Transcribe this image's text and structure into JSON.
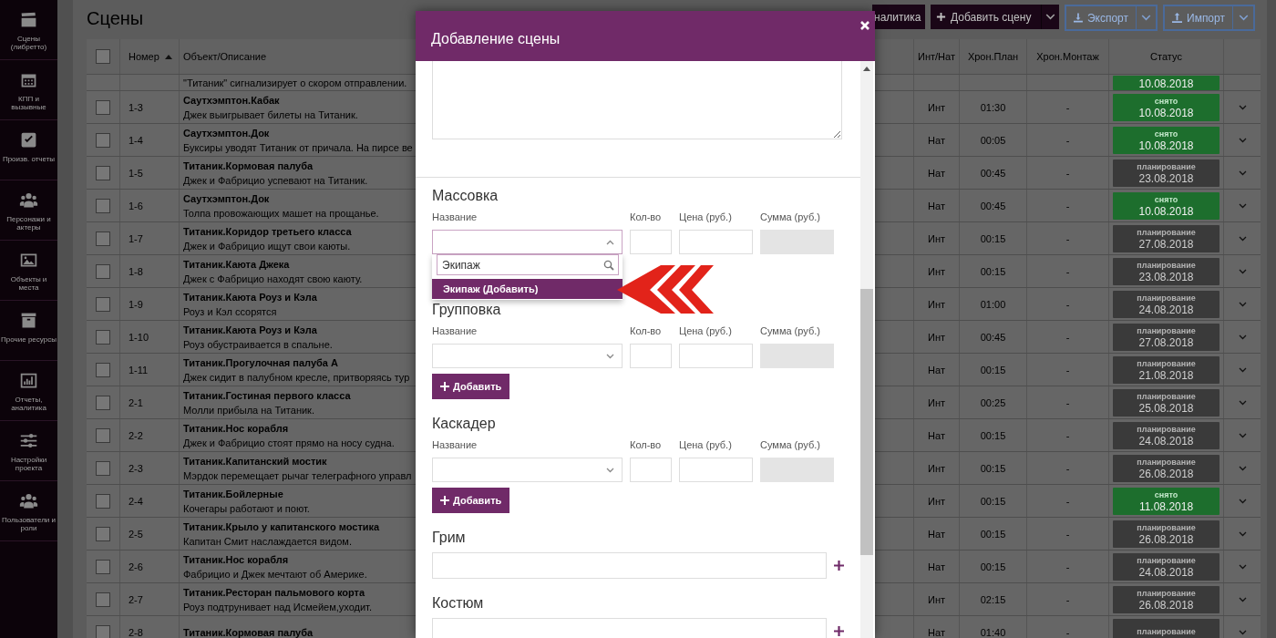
{
  "sidebar": {
    "items": [
      {
        "label": "Сцены (либретто)"
      },
      {
        "label": "КПП и вызывные"
      },
      {
        "label": "Произв. отчеты"
      },
      {
        "label": "Персонажи и актеры"
      },
      {
        "label": "Объекты и места"
      },
      {
        "label": "Прочие ресурсы"
      },
      {
        "label": "Отчеты, аналитика"
      },
      {
        "label": "Настройки проекта"
      },
      {
        "label": "Пользователи и роли"
      }
    ]
  },
  "page": {
    "title": "Сцены"
  },
  "toolbar": {
    "buttons": [
      {
        "label": "налитика",
        "kind": "dark",
        "split": false
      },
      {
        "label": "Добавить сцену",
        "kind": "primary",
        "split": true
      },
      {
        "label": "Экспорт",
        "kind": "outline",
        "split": true
      },
      {
        "label": "Импорт",
        "kind": "outline",
        "split": true
      }
    ]
  },
  "table": {
    "select_all": {
      "checked": false
    },
    "columns": [
      {
        "label": "Номер",
        "sorted_ascending": true
      },
      {
        "label": "Объект/Описание",
        "sorted_ascending": false
      },
      {
        "label": "Инт/Нат",
        "sorted_ascending": false
      },
      {
        "label": "Хрон.План",
        "sorted_ascending": false
      },
      {
        "label": "Хрон.Монтаж",
        "sorted_ascending": false
      },
      {
        "label": "Статус",
        "sorted_ascending": false
      }
    ],
    "rows": [
      {
        "description": "\"Титаник\" сигнализирует о скором отправлении.",
        "status": {
          "kind": "done",
          "date": "10.08.2018"
        }
      },
      {
        "checked": false,
        "number": "1-3",
        "title": "Саутхэмптон.Кабак",
        "description": "Джек выигрывает билеты на Титаник.",
        "int_nat": "Инт",
        "plan": "01:30",
        "montage": "-",
        "status": {
          "kind": "done",
          "label": "снято",
          "date": "10.08.2018"
        }
      },
      {
        "checked": false,
        "number": "1-4",
        "title": "Саутхэмптон.Док",
        "description": "Буксиры уводят Титаник от причала. На пирсе ве",
        "int_nat": "Нат",
        "plan": "00:05",
        "montage": "-",
        "status": {
          "kind": "done",
          "label": "снято",
          "date": "10.08.2018"
        }
      },
      {
        "checked": false,
        "number": "1-5",
        "title": "Титаник.Кормовая палуба",
        "description": "Джек и Фабрицио успевают на Титаник.",
        "int_nat": "Нат",
        "plan": "00:45",
        "montage": "-",
        "status": {
          "kind": "planned",
          "label": "планирование",
          "date": "23.08.2018"
        }
      },
      {
        "checked": false,
        "number": "1-6",
        "title": "Саутхэмптон.Док",
        "description": "Толпа провожающих машет на прощанье.",
        "int_nat": "Нат",
        "plan": "00:45",
        "montage": "-",
        "status": {
          "kind": "done",
          "label": "снято",
          "date": "10.08.2018"
        }
      },
      {
        "checked": false,
        "number": "1-7",
        "title": "Титаник.Коридор третьего класса",
        "description": "Джек и Фабрицио ищут свои каюты.",
        "int_nat": "Инт",
        "plan": "00:15",
        "montage": "-",
        "status": {
          "kind": "planned",
          "label": "планирование",
          "date": "27.08.2018"
        }
      },
      {
        "checked": false,
        "number": "1-8",
        "title": "Титаник.Каюта Джека",
        "description": "Джек с Фабрицио находят свою каюту.",
        "int_nat": "Инт",
        "plan": "00:15",
        "montage": "-",
        "status": {
          "kind": "planned",
          "label": "планирование",
          "date": "23.08.2018"
        }
      },
      {
        "checked": false,
        "number": "1-9",
        "title": "Титаник.Каюта Роуз и Кэла",
        "description": "Роуз и Кэл ссорятся",
        "int_nat": "Инт",
        "plan": "01:00",
        "montage": "-",
        "status": {
          "kind": "planned",
          "label": "планирование",
          "date": "24.08.2018"
        }
      },
      {
        "checked": false,
        "number": "1-10",
        "title": "Титаник.Каюта Роуз и Кэла",
        "description": "Роуз обустраивается в спальне.",
        "int_nat": "Инт",
        "plan": "00:45",
        "montage": "-",
        "status": {
          "kind": "planned",
          "label": "планирование",
          "date": "27.08.2018"
        }
      },
      {
        "checked": false,
        "number": "1-11",
        "title": "Титаник.Прогулочная палуба А",
        "description": "Джек сидит в палубном кресле, притворяясь тур",
        "int_nat": "Нат",
        "plan": "00:15",
        "montage": "-",
        "status": {
          "kind": "planned",
          "label": "планирование",
          "date": "21.08.2018"
        }
      },
      {
        "checked": false,
        "number": "2-1",
        "title": "Титаник.Гостиная первого класса",
        "description": "Молли прибыла на Титаник.",
        "int_nat": "Инт",
        "plan": "00:25",
        "montage": "-",
        "status": {
          "kind": "planned",
          "label": "планирование",
          "date": "25.08.2018"
        }
      },
      {
        "checked": false,
        "number": "2-2",
        "title": "Титаник.Нос корабля",
        "description": "Джек и Фабрицио стоят прямо на носу судна.",
        "int_nat": "Нат",
        "plan": "00:15",
        "montage": "-",
        "status": {
          "kind": "planned",
          "label": "планирование",
          "date": "24.08.2018"
        }
      },
      {
        "checked": false,
        "number": "2-3",
        "title": "Титаник.Капитанский мостик",
        "description": "Мэрдок перемещает рычаг телеграфного управл",
        "int_nat": "Инт",
        "plan": "00:15",
        "montage": "-",
        "status": {
          "kind": "planned",
          "label": "планирование",
          "date": "26.08.2018"
        }
      },
      {
        "checked": false,
        "number": "2-4",
        "title": "Титаник.Бойлерные",
        "description": "Кочегары работают и поют.",
        "int_nat": "Инт",
        "plan": "00:15",
        "montage": "-",
        "status": {
          "kind": "done",
          "label": "снято",
          "date": "11.08.2018"
        }
      },
      {
        "checked": false,
        "number": "2-5",
        "title": "Титаник.Крыло у капитанского мостика",
        "description": "Капитан Смит наслаждается видом.",
        "int_nat": "Нат",
        "plan": "00:15",
        "montage": "-",
        "status": {
          "kind": "planned",
          "label": "планирование",
          "date": "26.08.2018"
        }
      },
      {
        "checked": false,
        "number": "2-6",
        "title": "Титаник.Нос корабля",
        "description": "Фабрицио и Джек мечтают об Америке.",
        "int_nat": "Нат",
        "plan": "00:15",
        "montage": "-",
        "status": {
          "kind": "planned",
          "label": "планирование",
          "date": "24.08.2018"
        }
      },
      {
        "checked": false,
        "number": "2-7",
        "title": "Титаник.Ресторан пальмового корта",
        "description": "Роуз подтрунивает над Исмейем,уходит.",
        "int_nat": "Инт",
        "plan": "02:15",
        "montage": "-",
        "status": {
          "kind": "planned",
          "label": "планирование",
          "date": "26.08.2018"
        }
      },
      {
        "checked": false,
        "number": "2-8",
        "title": "Титаник.Кормовая палуба",
        "int_nat": "Нат",
        "plan": "01:40",
        "montage": "-",
        "status": {
          "kind": "planned",
          "label": "планирование"
        }
      }
    ]
  },
  "modal": {
    "title": "Добавление сцены",
    "sections": [
      {
        "kind": "table",
        "heading": "Массовка",
        "columns": [
          {
            "label": "Название",
            "kind": "select"
          },
          {
            "label": "Кол-во",
            "kind": "input",
            "disabled": false
          },
          {
            "label": "Цена (руб.)",
            "kind": "input",
            "disabled": false
          },
          {
            "label": "Сумма (руб.)",
            "kind": "input",
            "disabled": true
          }
        ],
        "select": {
          "open": true,
          "search": "Экипаж",
          "options": [
            {
              "label": "Экипаж (Добавить)",
              "selected": true
            }
          ]
        }
      },
      {
        "kind": "table",
        "heading": "Групповка",
        "columns": [
          {
            "label": "Название",
            "kind": "select"
          },
          {
            "label": "Кол-во",
            "kind": "input",
            "disabled": false
          },
          {
            "label": "Цена (руб.)",
            "kind": "input",
            "disabled": false
          },
          {
            "label": "Сумма (руб.)",
            "kind": "input",
            "disabled": true
          }
        ],
        "select": {
          "open": false
        },
        "button": "Добавить"
      },
      {
        "kind": "table",
        "heading": "Каскадер",
        "columns": [
          {
            "label": "Название",
            "kind": "select"
          },
          {
            "label": "Кол-во",
            "kind": "input",
            "disabled": false
          },
          {
            "label": "Цена (руб.)",
            "kind": "input",
            "disabled": false
          },
          {
            "label": "Сумма (руб.)",
            "kind": "input",
            "disabled": true
          }
        ],
        "select": {
          "open": false
        },
        "button": "Добавить"
      },
      {
        "kind": "text",
        "heading": "Грим"
      },
      {
        "kind": "text",
        "heading": "Костюм"
      }
    ]
  }
}
